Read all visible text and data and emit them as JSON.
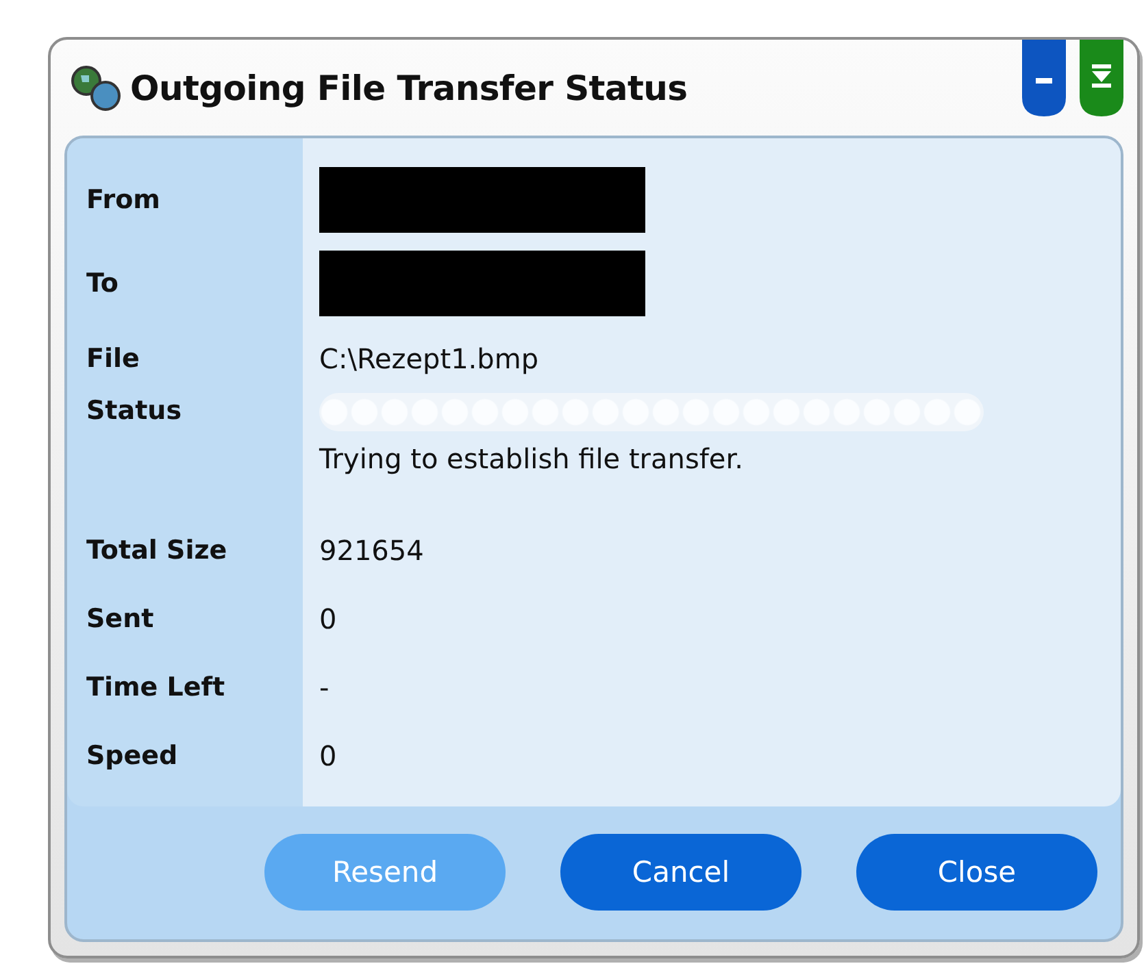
{
  "window": {
    "title": "Outgoing File Transfer Status"
  },
  "fields": [
    {
      "label": "From",
      "kind": "redacted"
    },
    {
      "label": "To",
      "kind": "redacted"
    },
    {
      "label": "File",
      "kind": "text",
      "value": "C:\\Rezept1.bmp"
    },
    {
      "label": "Status",
      "kind": "progress",
      "level": 0,
      "message": "Trying to establish file transfer."
    },
    {
      "label": "Total Size",
      "kind": "text",
      "value": "921654"
    },
    {
      "label": "Sent",
      "kind": "text",
      "value": "0"
    },
    {
      "label": "Time Left",
      "kind": "text",
      "value": "-"
    },
    {
      "label": "Speed",
      "kind": "text",
      "value": "0"
    }
  ],
  "buttons": [
    {
      "label": "Resend",
      "disabled": true
    },
    {
      "label": "Cancel",
      "disabled": false
    },
    {
      "label": "Close",
      "disabled": false
    }
  ]
}
